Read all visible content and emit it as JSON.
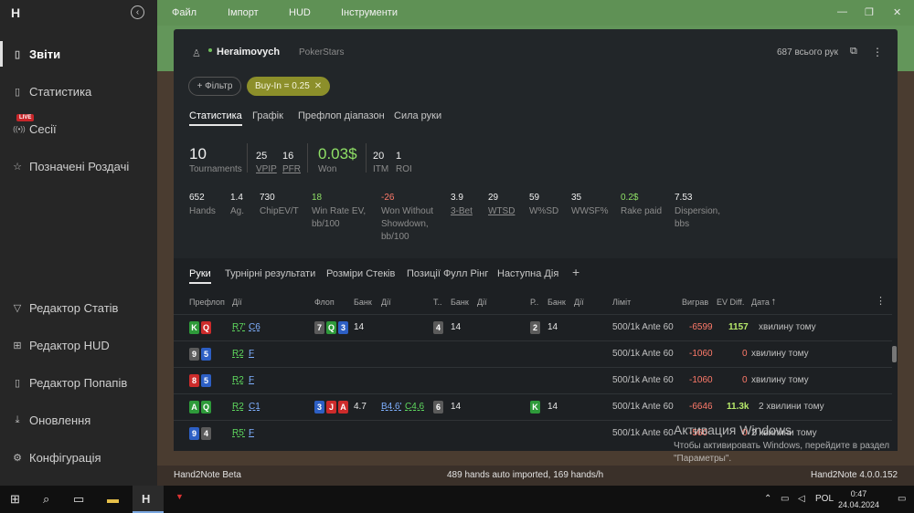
{
  "sidebar": {
    "logo": "H",
    "items": [
      {
        "label": "Звіти",
        "icon": "report-icon",
        "glyph": "▯"
      },
      {
        "label": "Статистика",
        "icon": "statistics-icon",
        "glyph": "▯"
      },
      {
        "label": "Сесії",
        "icon": "broadcast-icon",
        "glyph": "((•))",
        "badge": "LIVE"
      },
      {
        "label": "Позначені Роздачі",
        "icon": "star-list-icon",
        "glyph": "☆"
      },
      {
        "label": "Редактор Статів",
        "icon": "filter-icon",
        "glyph": "▽"
      },
      {
        "label": "Редактор HUD",
        "icon": "layout-icon",
        "glyph": "⊞"
      },
      {
        "label": "Редактор Попапів",
        "icon": "popup-icon",
        "glyph": "▯"
      },
      {
        "label": "Оновлення",
        "icon": "download-icon",
        "glyph": "⤓"
      },
      {
        "label": "Конфігурація",
        "icon": "gear-icon",
        "glyph": "⚙"
      }
    ]
  },
  "menu": [
    "Файл",
    "Імпорт",
    "HUD",
    "Інструменти"
  ],
  "player": {
    "name": "Heraimovych",
    "site": "PokerStars",
    "hands_total": "687 всього рук"
  },
  "filter": {
    "label": "+ Фільтр",
    "chip": "Buy-In = 0.25"
  },
  "tabs": [
    "Статистика",
    "Графік",
    "Префлоп діапазон",
    "Сила руки"
  ],
  "stats_top": {
    "tournaments": {
      "value": "10",
      "label": "Tournaments"
    },
    "vpip": {
      "value": "25",
      "label": "VPIP"
    },
    "pfr": {
      "value": "16",
      "label": "PFR"
    },
    "won": {
      "value": "0.03$",
      "label": "Won"
    },
    "itm": {
      "value": "20",
      "label": "ITM"
    },
    "roi": {
      "value": "1",
      "label": "ROI"
    }
  },
  "stats_row": [
    {
      "value": "652",
      "label": "Hands"
    },
    {
      "value": "1.4",
      "label": "Ag."
    },
    {
      "value": "730",
      "label": "ChipEV/T"
    },
    {
      "value": "18",
      "label": "Win Rate EV, bb/100"
    },
    {
      "value": "-26",
      "label": "Won Without Showdown, bb/100"
    },
    {
      "value": "3.9",
      "label": "3-Bet"
    },
    {
      "value": "29",
      "label": "WTSD"
    },
    {
      "value": "59",
      "label": "W%SD"
    },
    {
      "value": "35",
      "label": "WWSF%"
    },
    {
      "value": "0.2$",
      "label": "Rake paid"
    },
    {
      "value": "7.53",
      "label": "Dispersion, bbs"
    }
  ],
  "lower_tabs": [
    "Руки",
    "Турнірні результати",
    "Розміри Стеків",
    "Позиції Фулл Рінг",
    "Наступна Дія"
  ],
  "columns": [
    "Префлоп",
    "Дії",
    "Флоп",
    "Банк",
    "Дії",
    "Т..",
    "Банк",
    "Дії",
    "Р..",
    "Банк",
    "Дії",
    "Ліміт",
    "Виграв",
    "EV Diff.",
    "Дата ⭡"
  ],
  "rows": [
    {
      "pre": [
        [
          "K",
          "g"
        ],
        [
          "Q",
          "r"
        ]
      ],
      "pre_act": "R7'",
      "pre_act2": "C6",
      "flop": [
        [
          "7",
          "k"
        ],
        [
          "Q",
          "g"
        ],
        [
          "3",
          "b"
        ]
      ],
      "flop_pot": "14",
      "flop_act": "",
      "flop_act2": "",
      "turn": [
        [
          "4",
          "k"
        ]
      ],
      "turn_pot": "14",
      "river": [
        [
          "2",
          "k"
        ]
      ],
      "river_pot": "14",
      "limit": "500/1k Ante 60",
      "won": "-6599",
      "ev": "1157",
      "date": "хвилину тому"
    },
    {
      "pre": [
        [
          "9",
          "k"
        ],
        [
          "5",
          "b"
        ]
      ],
      "pre_act": "R2",
      "pre_act2": "F",
      "flop": [],
      "flop_pot": "",
      "flop_act": "",
      "flop_act2": "",
      "turn": [],
      "turn_pot": "",
      "river": [],
      "river_pot": "",
      "limit": "500/1k Ante 60",
      "won": "-1060",
      "ev": "0",
      "date": "хвилину тому"
    },
    {
      "pre": [
        [
          "8",
          "r"
        ],
        [
          "5",
          "b"
        ]
      ],
      "pre_act": "R2",
      "pre_act2": "F",
      "flop": [],
      "flop_pot": "",
      "flop_act": "",
      "flop_act2": "",
      "turn": [],
      "turn_pot": "",
      "river": [],
      "river_pot": "",
      "limit": "500/1k Ante 60",
      "won": "-1060",
      "ev": "0",
      "date": "хвилину тому"
    },
    {
      "pre": [
        [
          "A",
          "g"
        ],
        [
          "Q",
          "g"
        ]
      ],
      "pre_act": "R2",
      "pre_act2": "C1",
      "flop": [
        [
          "3",
          "b"
        ],
        [
          "J",
          "r"
        ],
        [
          "A",
          "r"
        ]
      ],
      "flop_pot": "4.7",
      "flop_act": "B4.6'",
      "flop_act2": "C4.6",
      "turn": [
        [
          "6",
          "k"
        ]
      ],
      "turn_pot": "14",
      "river": [
        [
          "K",
          "g"
        ]
      ],
      "river_pot": "14",
      "limit": "500/1k Ante 60",
      "won": "-6646",
      "ev": "11.3k",
      "date": "2 хвилини тому"
    },
    {
      "pre": [
        [
          "9",
          "b"
        ],
        [
          "4",
          "k"
        ]
      ],
      "pre_act": "R5'",
      "pre_act2": "F",
      "flop": [],
      "flop_pot": "",
      "flop_act": "",
      "flop_act2": "",
      "turn": [],
      "turn_pot": "",
      "river": [],
      "river_pot": "",
      "limit": "500/1k Ante 60",
      "won": "-560",
      "ev": "0",
      "date": "2 хвилини тому"
    }
  ],
  "status": {
    "left": "Hand2Note Beta",
    "center": "489 hands auto imported, 169 hands/h",
    "right": "Hand2Note 4.0.0.152"
  },
  "watermark": {
    "title": "Активация Windows",
    "text": "Чтобы активировать Windows, перейдите в раздел \"Параметры\"."
  },
  "taskbar": {
    "lang": "POL",
    "time": "0:47",
    "date": "24.04.2024"
  }
}
